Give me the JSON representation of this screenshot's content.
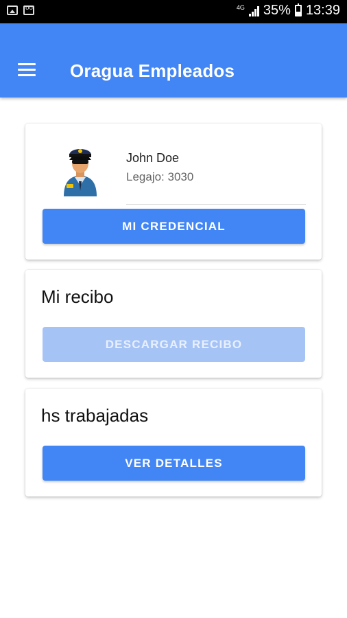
{
  "status_bar": {
    "network": "4G",
    "battery": "35%",
    "time": "13:39"
  },
  "app_bar": {
    "title": "Oragua Empleados"
  },
  "employee_card": {
    "name": "John Doe",
    "legajo": "Legajo: 3030",
    "button_label": "MI CREDENCIAL"
  },
  "recibo_card": {
    "title": "Mi recibo",
    "button_label": "DESCARGAR RECIBO"
  },
  "horas_card": {
    "title": "hs trabajadas",
    "button_label": "VER DETALLES"
  },
  "colors": {
    "primary": "#4285f4",
    "disabled_button": "#a6c3f6"
  },
  "icons": [
    "image-icon",
    "voicemail-icon",
    "signal-icon",
    "battery-icon",
    "menu-icon",
    "police-avatar-icon"
  ]
}
